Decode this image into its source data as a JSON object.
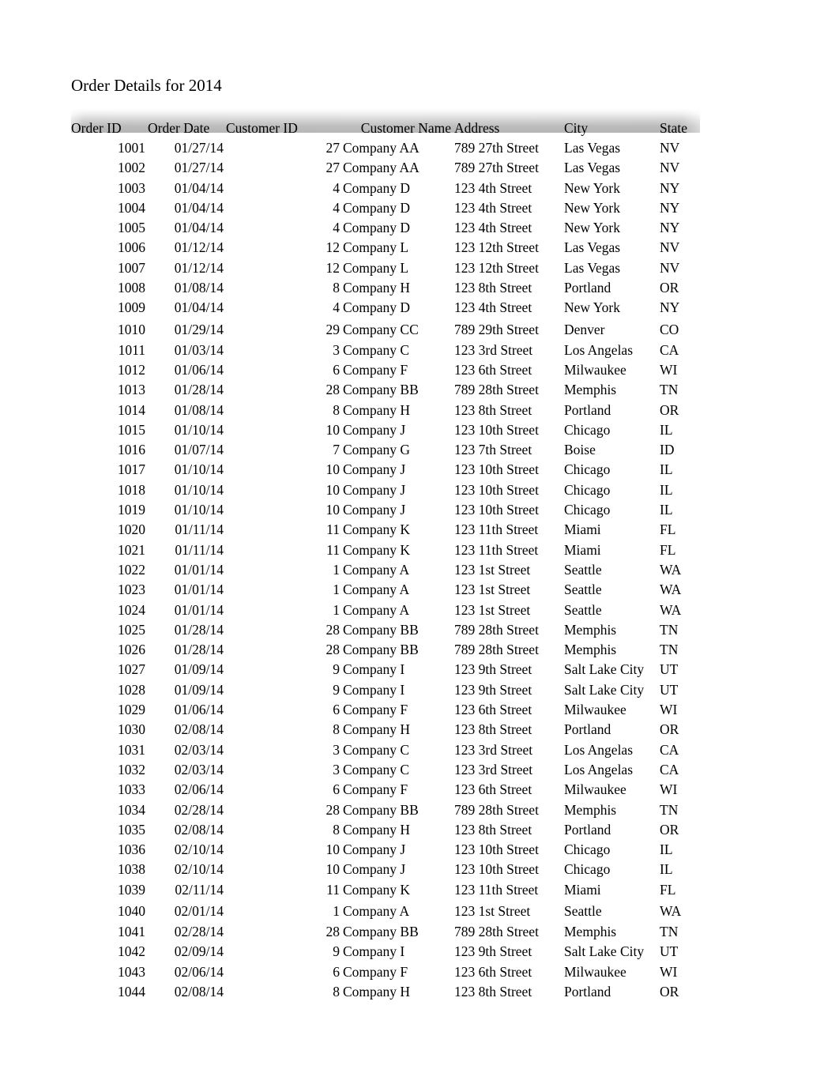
{
  "document": {
    "title": "Order Details for 2014"
  },
  "table": {
    "columns": [
      {
        "key": "order_id",
        "label": "Order ID",
        "align": "right"
      },
      {
        "key": "order_date",
        "label": "Order Date",
        "align": "right"
      },
      {
        "key": "customer_id",
        "label": "Customer ID",
        "align": "right"
      },
      {
        "key": "customer_name",
        "label": "Customer Name",
        "align": "left"
      },
      {
        "key": "address",
        "label": "Address",
        "align": "left"
      },
      {
        "key": "city",
        "label": "City",
        "align": "left"
      },
      {
        "key": "state",
        "label": "State",
        "align": "left"
      }
    ],
    "rows": [
      {
        "order_id": "1001",
        "order_date": "01/27/14",
        "customer_id": "27",
        "customer_name": "Company AA",
        "address": "789 27th Street",
        "city": "Las Vegas",
        "state": "NV"
      },
      {
        "order_id": "1002",
        "order_date": "01/27/14",
        "customer_id": "27",
        "customer_name": "Company AA",
        "address": "789 27th Street",
        "city": "Las Vegas",
        "state": "NV"
      },
      {
        "order_id": "1003",
        "order_date": "01/04/14",
        "customer_id": "4",
        "customer_name": "Company D",
        "address": "123 4th Street",
        "city": "New York",
        "state": "NY"
      },
      {
        "order_id": "1004",
        "order_date": "01/04/14",
        "customer_id": "4",
        "customer_name": "Company D",
        "address": "123 4th Street",
        "city": "New York",
        "state": "NY"
      },
      {
        "order_id": "1005",
        "order_date": "01/04/14",
        "customer_id": "4",
        "customer_name": "Company D",
        "address": "123 4th Street",
        "city": "New York",
        "state": "NY"
      },
      {
        "order_id": "1006",
        "order_date": "01/12/14",
        "customer_id": "12",
        "customer_name": "Company L",
        "address": "123 12th Street",
        "city": "Las Vegas",
        "state": "NV"
      },
      {
        "order_id": "1007",
        "order_date": "01/12/14",
        "customer_id": "12",
        "customer_name": "Company L",
        "address": "123 12th Street",
        "city": "Las Vegas",
        "state": "NV"
      },
      {
        "order_id": "1008",
        "order_date": "01/08/14",
        "customer_id": "8",
        "customer_name": "Company H",
        "address": "123 8th Street",
        "city": "Portland",
        "state": "OR"
      },
      {
        "order_id": "1009",
        "order_date": "01/04/14",
        "customer_id": "4",
        "customer_name": "Company D",
        "address": "123 4th Street",
        "city": "New York",
        "state": "NY"
      },
      {
        "order_id": "1010",
        "order_date": "01/29/14",
        "customer_id": "29",
        "customer_name": "Company CC",
        "address": "789 29th Street",
        "city": "Denver",
        "state": "CO"
      },
      {
        "order_id": "1011",
        "order_date": "01/03/14",
        "customer_id": "3",
        "customer_name": "Company C",
        "address": "123 3rd Street",
        "city": "Los Angelas",
        "state": "CA"
      },
      {
        "order_id": "1012",
        "order_date": "01/06/14",
        "customer_id": "6",
        "customer_name": "Company F",
        "address": "123 6th Street",
        "city": "Milwaukee",
        "state": "WI"
      },
      {
        "order_id": "1013",
        "order_date": "01/28/14",
        "customer_id": "28",
        "customer_name": "Company BB",
        "address": "789 28th Street",
        "city": "Memphis",
        "state": "TN"
      },
      {
        "order_id": "1014",
        "order_date": "01/08/14",
        "customer_id": "8",
        "customer_name": "Company H",
        "address": "123 8th Street",
        "city": "Portland",
        "state": "OR"
      },
      {
        "order_id": "1015",
        "order_date": "01/10/14",
        "customer_id": "10",
        "customer_name": "Company J",
        "address": "123 10th Street",
        "city": "Chicago",
        "state": "IL"
      },
      {
        "order_id": "1016",
        "order_date": "01/07/14",
        "customer_id": "7",
        "customer_name": "Company G",
        "address": "123 7th Street",
        "city": "Boise",
        "state": "ID"
      },
      {
        "order_id": "1017",
        "order_date": "01/10/14",
        "customer_id": "10",
        "customer_name": "Company J",
        "address": "123 10th Street",
        "city": "Chicago",
        "state": "IL"
      },
      {
        "order_id": "1018",
        "order_date": "01/10/14",
        "customer_id": "10",
        "customer_name": "Company J",
        "address": "123 10th Street",
        "city": "Chicago",
        "state": "IL"
      },
      {
        "order_id": "1019",
        "order_date": "01/10/14",
        "customer_id": "10",
        "customer_name": "Company J",
        "address": "123 10th Street",
        "city": "Chicago",
        "state": "IL"
      },
      {
        "order_id": "1020",
        "order_date": "01/11/14",
        "customer_id": "11",
        "customer_name": "Company K",
        "address": "123 11th Street",
        "city": "Miami",
        "state": "FL"
      },
      {
        "order_id": "1021",
        "order_date": "01/11/14",
        "customer_id": "11",
        "customer_name": "Company K",
        "address": "123 11th Street",
        "city": "Miami",
        "state": "FL"
      },
      {
        "order_id": "1022",
        "order_date": "01/01/14",
        "customer_id": "1",
        "customer_name": "Company A",
        "address": "123 1st Street",
        "city": "Seattle",
        "state": "WA"
      },
      {
        "order_id": "1023",
        "order_date": "01/01/14",
        "customer_id": "1",
        "customer_name": "Company A",
        "address": "123 1st Street",
        "city": "Seattle",
        "state": "WA"
      },
      {
        "order_id": "1024",
        "order_date": "01/01/14",
        "customer_id": "1",
        "customer_name": "Company A",
        "address": "123 1st Street",
        "city": "Seattle",
        "state": "WA"
      },
      {
        "order_id": "1025",
        "order_date": "01/28/14",
        "customer_id": "28",
        "customer_name": "Company BB",
        "address": "789 28th Street",
        "city": "Memphis",
        "state": "TN"
      },
      {
        "order_id": "1026",
        "order_date": "01/28/14",
        "customer_id": "28",
        "customer_name": "Company BB",
        "address": "789 28th Street",
        "city": "Memphis",
        "state": "TN"
      },
      {
        "order_id": "1027",
        "order_date": "01/09/14",
        "customer_id": "9",
        "customer_name": "Company I",
        "address": "123 9th Street",
        "city": "Salt Lake City",
        "state": "UT"
      },
      {
        "order_id": "1028",
        "order_date": "01/09/14",
        "customer_id": "9",
        "customer_name": "Company I",
        "address": "123 9th Street",
        "city": "Salt Lake City",
        "state": "UT"
      },
      {
        "order_id": "1029",
        "order_date": "01/06/14",
        "customer_id": "6",
        "customer_name": "Company F",
        "address": "123 6th Street",
        "city": "Milwaukee",
        "state": "WI"
      },
      {
        "order_id": "1030",
        "order_date": "02/08/14",
        "customer_id": "8",
        "customer_name": "Company H",
        "address": "123 8th Street",
        "city": "Portland",
        "state": "OR"
      },
      {
        "order_id": "1031",
        "order_date": "02/03/14",
        "customer_id": "3",
        "customer_name": "Company C",
        "address": "123 3rd Street",
        "city": "Los Angelas",
        "state": "CA"
      },
      {
        "order_id": "1032",
        "order_date": "02/03/14",
        "customer_id": "3",
        "customer_name": "Company C",
        "address": "123 3rd Street",
        "city": "Los Angelas",
        "state": "CA"
      },
      {
        "order_id": "1033",
        "order_date": "02/06/14",
        "customer_id": "6",
        "customer_name": "Company F",
        "address": "123 6th Street",
        "city": "Milwaukee",
        "state": "WI"
      },
      {
        "order_id": "1034",
        "order_date": "02/28/14",
        "customer_id": "28",
        "customer_name": "Company BB",
        "address": "789 28th Street",
        "city": "Memphis",
        "state": "TN"
      },
      {
        "order_id": "1035",
        "order_date": "02/08/14",
        "customer_id": "8",
        "customer_name": "Company H",
        "address": "123 8th Street",
        "city": "Portland",
        "state": "OR"
      },
      {
        "order_id": "1036",
        "order_date": "02/10/14",
        "customer_id": "10",
        "customer_name": "Company J",
        "address": "123 10th Street",
        "city": "Chicago",
        "state": "IL"
      },
      {
        "order_id": "1038",
        "order_date": "02/10/14",
        "customer_id": "10",
        "customer_name": "Company J",
        "address": "123 10th Street",
        "city": "Chicago",
        "state": "IL"
      },
      {
        "order_id": "1039",
        "order_date": "02/11/14",
        "customer_id": "11",
        "customer_name": "Company K",
        "address": "123 11th Street",
        "city": "Miami",
        "state": "FL"
      },
      {
        "order_id": "1040",
        "order_date": "02/01/14",
        "customer_id": "1",
        "customer_name": "Company A",
        "address": "123 1st Street",
        "city": "Seattle",
        "state": "WA"
      },
      {
        "order_id": "1041",
        "order_date": "02/28/14",
        "customer_id": "28",
        "customer_name": "Company BB",
        "address": "789 28th Street",
        "city": "Memphis",
        "state": "TN"
      },
      {
        "order_id": "1042",
        "order_date": "02/09/14",
        "customer_id": "9",
        "customer_name": "Company I",
        "address": "123 9th Street",
        "city": "Salt Lake City",
        "state": "UT"
      },
      {
        "order_id": "1043",
        "order_date": "02/06/14",
        "customer_id": "6",
        "customer_name": "Company F",
        "address": "123 6th Street",
        "city": "Milwaukee",
        "state": "WI"
      },
      {
        "order_id": "1044",
        "order_date": "02/08/14",
        "customer_id": "8",
        "customer_name": "Company H",
        "address": "123 8th Street",
        "city": "Portland",
        "state": "OR"
      }
    ],
    "taller_rows": [
      "1010",
      "1040"
    ]
  }
}
